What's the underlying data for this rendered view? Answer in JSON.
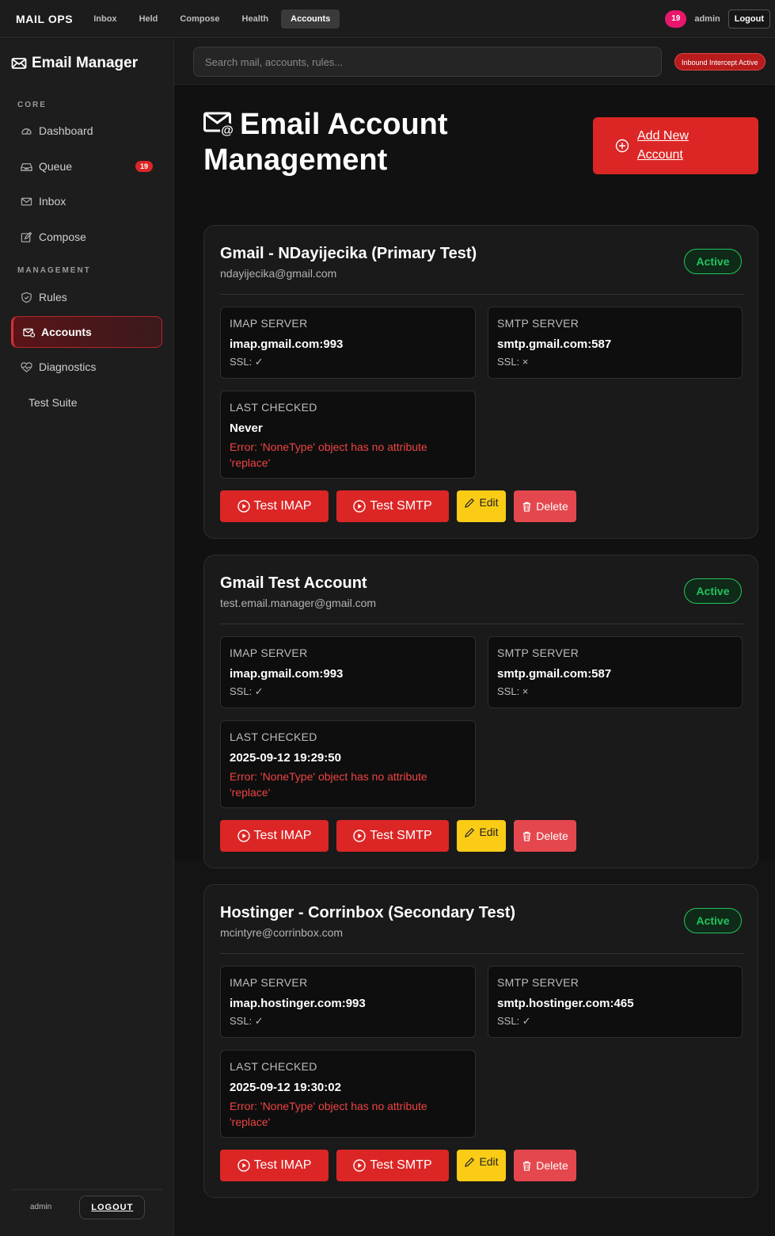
{
  "topnav": {
    "brand": "MAIL OPS",
    "links": [
      "Inbox",
      "Held",
      "Compose",
      "Health",
      "Accounts"
    ],
    "badge_count": "19",
    "user": "admin",
    "logout_label": "Logout"
  },
  "sidebar": {
    "title": "Email Manager",
    "core_label": "CORE",
    "management_label": "MANAGEMENT",
    "items": [
      {
        "label": "Dashboard"
      },
      {
        "label": "Queue",
        "badge": "19"
      },
      {
        "label": "Inbox"
      },
      {
        "label": "Compose"
      },
      {
        "label": "Rules"
      },
      {
        "label": "Accounts"
      },
      {
        "label": "Diagnostics"
      },
      {
        "label": "Test Suite"
      }
    ],
    "footer_user": "admin",
    "footer_logout": "LOGOUT"
  },
  "search": {
    "placeholder": "Search mail, accounts, rules...",
    "intercept_badge": "Inbound Intercept Active"
  },
  "page": {
    "title": "Email Account Management",
    "add_button": "Add New Account"
  },
  "labels": {
    "imap_server": "IMAP SERVER",
    "smtp_server": "SMTP SERVER",
    "last_checked": "LAST CHECKED",
    "test_imap": "Test IMAP",
    "test_smtp": "Test SMTP",
    "edit": "Edit",
    "delete": "Delete"
  },
  "accounts": [
    {
      "name": "Gmail - NDayijecika (Primary Test)",
      "email": "ndayijecika@gmail.com",
      "status": "Active",
      "imap": "imap.gmail.com:993",
      "imap_ssl": "SSL: ✓",
      "smtp": "smtp.gmail.com:587",
      "smtp_ssl": "SSL: ×",
      "last_checked": "Never",
      "error": "Error: 'NoneType' object has no attribute 'replace'"
    },
    {
      "name": "Gmail Test Account",
      "email": "test.email.manager@gmail.com",
      "status": "Active",
      "imap": "imap.gmail.com:993",
      "imap_ssl": "SSL: ✓",
      "smtp": "smtp.gmail.com:587",
      "smtp_ssl": "SSL: ×",
      "last_checked": "2025-09-12 19:29:50",
      "error": "Error: 'NoneType' object has no attribute 'replace'"
    },
    {
      "name": "Hostinger - Corrinbox (Secondary Test)",
      "email": "mcintyre@corrinbox.com",
      "status": "Active",
      "imap": "imap.hostinger.com:993",
      "imap_ssl": "SSL: ✓",
      "smtp": "smtp.hostinger.com:465",
      "smtp_ssl": "SSL: ✓",
      "last_checked": "2025-09-12 19:30:02",
      "error": "Error: 'NoneType' object has no attribute 'replace'"
    }
  ]
}
